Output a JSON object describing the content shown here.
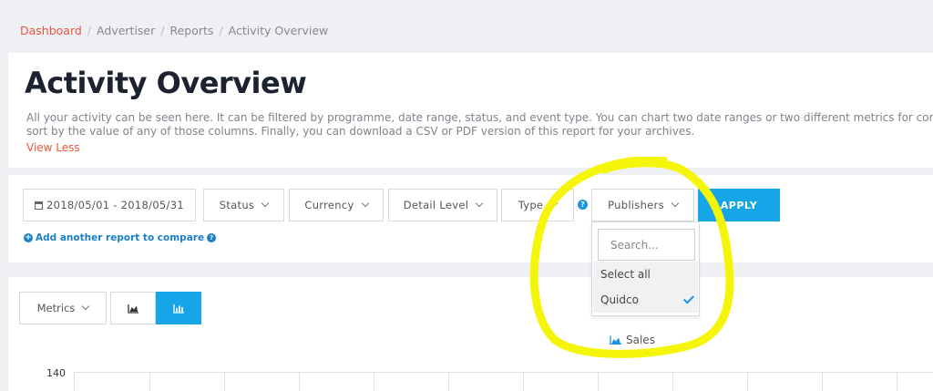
{
  "breadcrumb": {
    "items": [
      "Dashboard",
      "Advertiser",
      "Reports",
      "Activity Overview"
    ]
  },
  "header": {
    "title": "Activity Overview",
    "description_lines": [
      "All your activity can be seen here. It can be filtered by programme, date range, status, and event type. You can chart two date ranges or two different metrics for comparison",
      "sort by the value of any of those columns. Finally, you can download a CSV or PDF version of this report for your archives."
    ],
    "view_less": "View Less"
  },
  "filters": {
    "date_range": "2018/05/01 - 2018/05/31",
    "status": "Status",
    "currency": "Currency",
    "detail_level": "Detail Level",
    "type": "Type",
    "publishers": "Publishers",
    "apply": "APPLY",
    "add_compare": "Add another report to compare"
  },
  "publishers_dropdown": {
    "search_placeholder": "Search...",
    "select_all": "Select all",
    "options": [
      {
        "label": "Quidco",
        "selected": true
      }
    ]
  },
  "chart": {
    "metrics_label": "Metrics",
    "title": "Sales",
    "y_ticks": [
      "140"
    ]
  },
  "colors": {
    "accent": "#16a6e8",
    "link_red": "#e8553e",
    "annotation_yellow": "#f5f50a"
  }
}
